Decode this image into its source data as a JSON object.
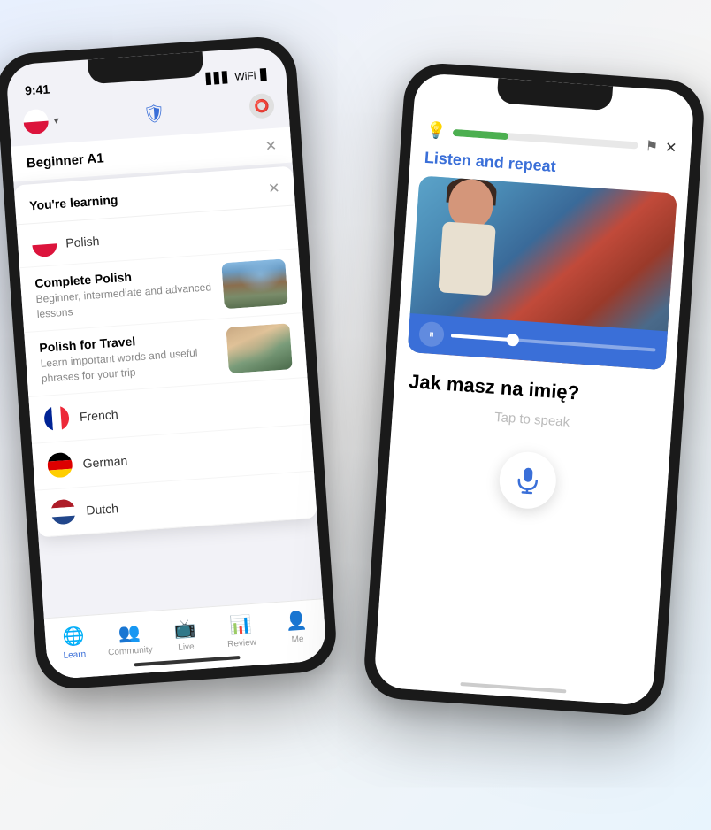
{
  "scene": {
    "background": "#eef2f7"
  },
  "left_phone": {
    "status_bar": {
      "time": "9:41",
      "signal": "▋▋▋",
      "wifi": "WiFi",
      "battery": "🔋"
    },
    "header": {
      "shield_label": "🛡",
      "dropdown_arrow": "▾",
      "profile_icon": "👤"
    },
    "beginner_bar": {
      "label": "Beginner A1",
      "close": "✕"
    },
    "dropdown": {
      "title": "You're learning",
      "close": "✕",
      "polish_flag_label": "Polish",
      "courses": [
        {
          "title": "Complete Polish",
          "subtitle": "Beginner, intermediate and advanced lessons",
          "thumb_type": "city"
        },
        {
          "title": "Polish for Travel",
          "subtitle": "Learn important words and useful phrases for your trip",
          "thumb_type": "travel"
        }
      ],
      "languages": [
        {
          "name": "French",
          "flag": "fr"
        },
        {
          "name": "German",
          "flag": "de"
        },
        {
          "name": "Dutch",
          "flag": "nl"
        }
      ]
    },
    "tab_bar": {
      "tabs": [
        {
          "label": "Learn",
          "active": true,
          "icon": "🌐"
        },
        {
          "label": "Community",
          "active": false,
          "icon": "👥"
        },
        {
          "label": "Live",
          "active": false,
          "icon": "👤"
        },
        {
          "label": "Review",
          "active": false,
          "icon": "📊"
        },
        {
          "label": "Me",
          "active": false,
          "icon": "👤"
        }
      ]
    }
  },
  "right_phone": {
    "top_bar": {
      "bulb": "💡",
      "progress": 30,
      "flag_icon": "⚑",
      "close": "✕"
    },
    "listen_repeat_label": "Listen and repeat",
    "audio_player": {
      "pause_icon": "⏸",
      "progress": 30
    },
    "sentence": "Jak masz na imię?",
    "tap_to_speak": "Tap to speak",
    "mic_icon": "🎤"
  }
}
